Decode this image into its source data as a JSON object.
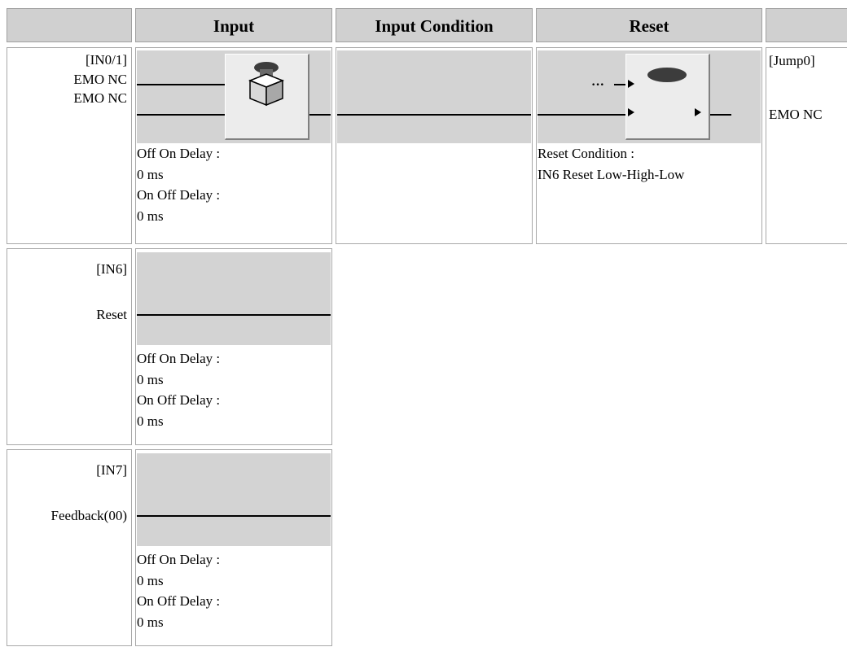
{
  "header": {
    "col_input": "Input",
    "col_input_condition": "Input Condition",
    "col_reset": "Reset"
  },
  "rows": [
    {
      "id": "[IN0/1]",
      "signal1": "EMO NC",
      "signal2": "EMO NC",
      "off_on_label": "Off On Delay :",
      "off_on_value": "0 ms",
      "on_off_label": "On Off Delay :",
      "on_off_value": "0 ms"
    },
    {
      "id": "[IN6]",
      "signal1": "Reset",
      "off_on_label": "Off On Delay :",
      "off_on_value": "0 ms",
      "on_off_label": "On Off Delay :",
      "on_off_value": "0 ms"
    },
    {
      "id": "[IN7]",
      "signal1": "Feedback(00)",
      "off_on_label": "Off On Delay :",
      "off_on_value": "0 ms",
      "on_off_label": "On Off Delay :",
      "on_off_value": "0 ms"
    }
  ],
  "reset": {
    "condition_label": "Reset Condition :",
    "condition_value": "IN6 Reset Low-High-Low",
    "dots": "···"
  },
  "output": {
    "id": "[Jump0]",
    "signal": "EMO NC"
  },
  "icons": [
    "emergency-stop-button-icon",
    "reset-button-icon",
    "arrow-right-icon"
  ],
  "colors": {
    "band": "#d3d3d3",
    "header": "#d0d0d0",
    "button_red": "#4a4a4a"
  }
}
